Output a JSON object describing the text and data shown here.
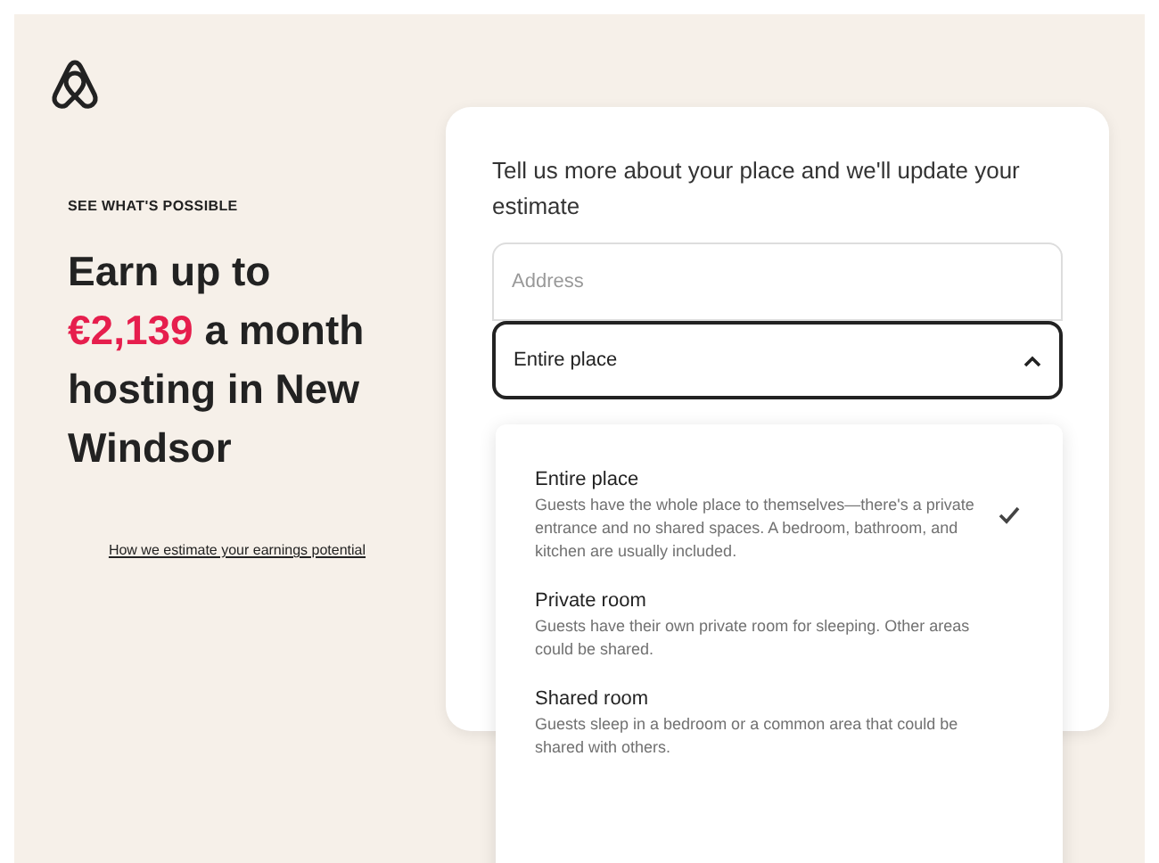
{
  "eyebrow": "SEE WHAT'S POSSIBLE",
  "headline": {
    "before": "Earn up to",
    "amount": "€2,139",
    "after": "a month hosting in New Windsor"
  },
  "link": "How we estimate your earnings potential",
  "form": {
    "prompt": "Tell us more about your place and we'll update your estimate",
    "address": {
      "placeholder": "Address"
    },
    "place_type": {
      "value": "Entire place",
      "expanded": true
    }
  },
  "options": [
    {
      "title": "Entire place",
      "description": "Guests have the whole place to themselves—there's a private entrance and no shared spaces. A bedroom, bathroom, and kitchen are usually included.",
      "selected": true
    },
    {
      "title": "Private room",
      "description": "Guests have their own private room for sleeping. Other areas could be shared.",
      "selected": false
    },
    {
      "title": "Shared room",
      "description": "Guests sleep in a bedroom or a common area that could be shared with others.",
      "selected": false
    }
  ]
}
